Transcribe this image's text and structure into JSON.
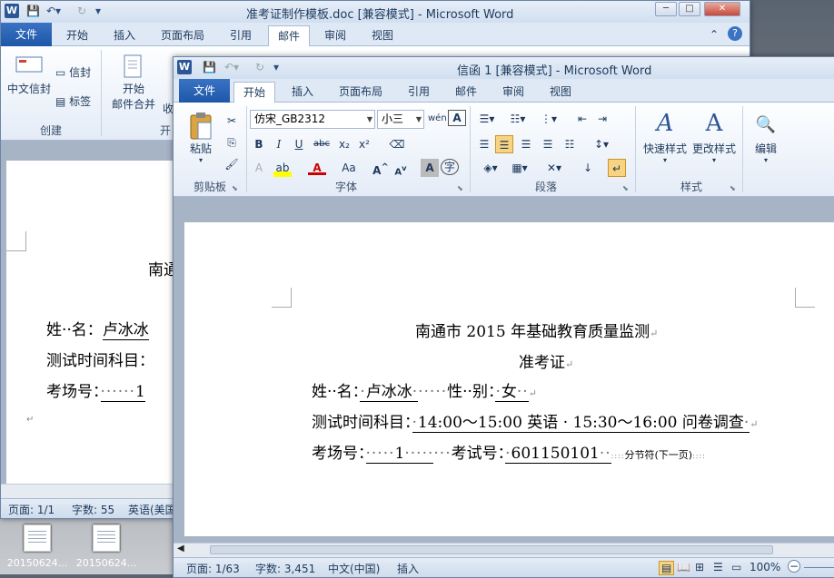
{
  "desktop": {
    "icons": [
      {
        "label": "20150624..."
      },
      {
        "label": "20150624..."
      }
    ]
  },
  "back_window": {
    "title": "准考证制作模板.doc [兼容模式] - Microsoft Word",
    "tabs": [
      "文件",
      "开始",
      "插入",
      "页面布局",
      "引用",
      "邮件",
      "审阅",
      "视图"
    ],
    "active_tab": "邮件",
    "ribbon": {
      "chinese_envelope": "中文信封",
      "envelope": "信封",
      "label": "标签",
      "group_create": "创建",
      "start_merge": "开始",
      "start_merge_2": "邮件合并",
      "recipients_partial": "收",
      "group_start_partial": "开"
    },
    "doc": {
      "title_partial": "南通",
      "line1_label": "姓··名：",
      "line1_value": "卢冰冰",
      "line2_label": "测试时间科目：",
      "line3_label": "考场号：",
      "line3_value": "1"
    },
    "status": {
      "page": "页面: 1/1",
      "words": "字数: 55",
      "lang": "英语(美国"
    }
  },
  "front_window": {
    "title": "信函 1 [兼容模式] - Microsoft Word",
    "tabs": [
      "文件",
      "开始",
      "插入",
      "页面布局",
      "引用",
      "邮件",
      "审阅",
      "视图"
    ],
    "active_tab": "开始",
    "ribbon": {
      "paste": "粘贴",
      "group_clipboard": "剪贴板",
      "font_name": "仿宋_GB2312",
      "font_size": "小三",
      "group_font": "字体",
      "group_paragraph": "段落",
      "quick_styles": "快速样式",
      "change_styles": "更改样式",
      "group_styles": "样式",
      "edit": "编辑"
    },
    "doc": {
      "title": "南通市 2015 年基础教育质量监测",
      "subtitle": "准考证",
      "name_label": "姓··名：",
      "name_value": "卢冰冰",
      "gender_label": "性··别：",
      "gender_value": "女",
      "subject_label": "测试时间科目：",
      "subject_value": "14:00～15:00 英语 · 15:30～16:00 问卷调查",
      "room_label": "考场号：",
      "room_value": "1",
      "exam_no_label": "考试号：",
      "exam_no_value": "601150101",
      "section_break": "分节符(下一页)"
    },
    "status": {
      "page": "页面: 1/63",
      "words": "字数: 3,451",
      "lang": "中文(中国)",
      "mode": "插入",
      "zoom": "100%"
    }
  },
  "colors": {
    "file_tab": "#2b5797",
    "title_text": "#1e395b",
    "ribbon_bg": "#e4ecf7"
  }
}
